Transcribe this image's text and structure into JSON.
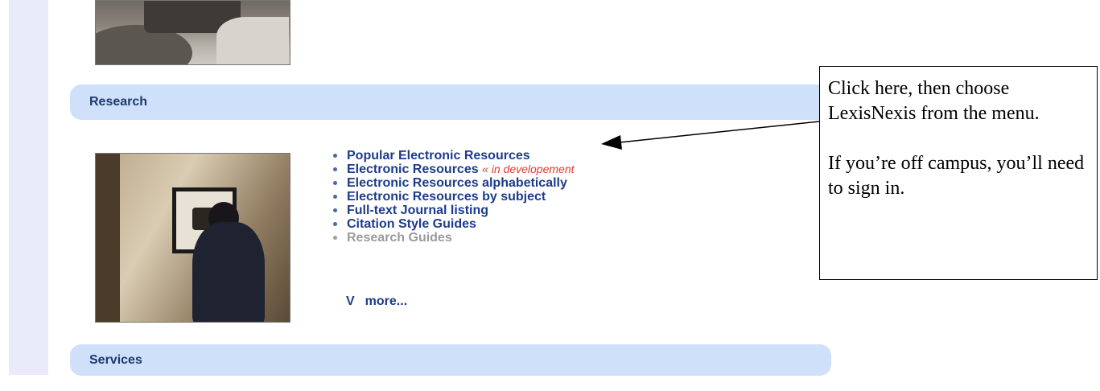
{
  "sections": {
    "research": {
      "title": "Research"
    },
    "services": {
      "title": "Services"
    }
  },
  "research_links": [
    {
      "label": "Popular Electronic Resources"
    },
    {
      "label": "Electronic Resources",
      "note": "« in developement"
    },
    {
      "label": "Electronic Resources alphabetically"
    },
    {
      "label": "Electronic Resources by subject"
    },
    {
      "label": "Full-text Journal listing"
    },
    {
      "label": "Citation Style Guides"
    },
    {
      "label": "Research Guides"
    }
  ],
  "more": {
    "chevron": "V",
    "label": "more..."
  },
  "callout": {
    "line1": "Click here, then choose LexisNexis from the menu.",
    "line2": "If you’re off campus, you’ll need to sign in."
  },
  "colors": {
    "section_bar": "#cfe0fb",
    "link": "#1d3b8c",
    "dev_note": "#e23b2e",
    "disabled_link": "#9a9a9a"
  }
}
